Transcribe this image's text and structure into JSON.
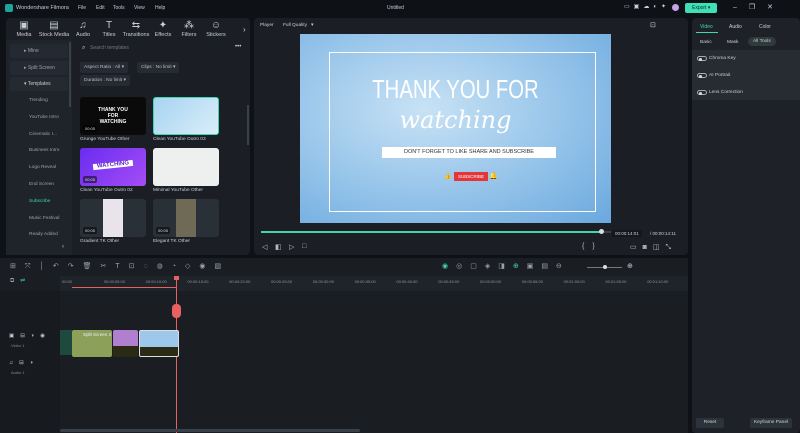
{
  "app": {
    "name": "Wondershare Filmora",
    "title": "Untitled",
    "menu": [
      "File",
      "Edit",
      "Tools",
      "View",
      "Help"
    ],
    "export": "Export"
  },
  "toolbar": [
    "Media",
    "Stock Media",
    "Audio",
    "Titles",
    "Transitions",
    "Effects",
    "Filters",
    "Stickers"
  ],
  "sidebar": {
    "categories": [
      "Mine",
      "Split Screen",
      "Templates"
    ],
    "items": [
      "Trending",
      "YouTube Intro",
      "Cinematic I...",
      "Business Intro",
      "Logo Reveal",
      "End Screen",
      "Subscribe",
      "Music Festival",
      "Ready Added"
    ],
    "active": "Subscribe"
  },
  "search": {
    "placeholder": "Search templates"
  },
  "filters": [
    "Aspect Ratio : All",
    "Clips : No limit",
    "Duration : No limit"
  ],
  "templates": [
    {
      "name": "Grunge YouTube Other",
      "duration": "00:05",
      "text": "THANK YOU FOR WATCHING"
    },
    {
      "name": "Clean YouTube Outro 03",
      "duration": ""
    },
    {
      "name": "Clean YouTube Outro 02",
      "duration": "00:05",
      "text": "WATCHING"
    },
    {
      "name": "Minimal YouTube Other",
      "duration": ""
    },
    {
      "name": "Gradient TK Other",
      "duration": "00:05"
    },
    {
      "name": "Elegant TK Other",
      "duration": "00:05"
    }
  ],
  "player": {
    "label": "Player",
    "quality": "Full Quality",
    "current": "00:00:14:01",
    "total": "00:00:14:11",
    "progress": 0.97,
    "preview": {
      "line1": "THANK YOU FOR",
      "line2": "watching",
      "line3": "DON'T FORGET TO LIKE SHARE AND SUBSCRIBE",
      "subscribe": "SUBSCRIBE"
    }
  },
  "right": {
    "tabs": [
      "Video",
      "Audio",
      "Color"
    ],
    "subtabs": [
      "Basic",
      "Mask",
      "All Tools"
    ],
    "tools": [
      "Chroma Key",
      "AI Portrait",
      "Lens Correction"
    ],
    "reset": "Reset",
    "keyframe": "Keyframe Panel"
  },
  "timeline": {
    "ruler": [
      "00:00",
      "00:00:05:00",
      "00:00:10:00",
      "00:00:15:00",
      "00:00:20:00",
      "00:00:25:00",
      "00:00:30:00",
      "00:00:35:00",
      "00:00:40:00",
      "00:00:45:00",
      "00:00:50:00",
      "00:00:55:00",
      "00:01:00:00",
      "00:01:05:00",
      "00:01:10:00"
    ],
    "tracks": [
      {
        "name": "Video 1"
      },
      {
        "name": "Audio 1"
      }
    ],
    "clips": [
      "Split Screen 4",
      "",
      ""
    ],
    "zoom": 0.5
  },
  "colors": {
    "accent": "#3fd6b0",
    "playhead": "#e8605f"
  }
}
